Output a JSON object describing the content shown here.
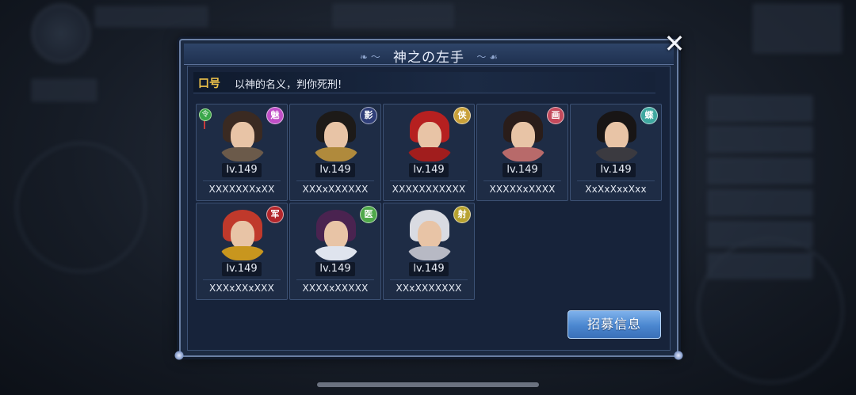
{
  "dialog": {
    "title": "神之の左手",
    "close_label": "✕"
  },
  "slogan": {
    "label": "口号",
    "text": "以神的名义，判你死刑!"
  },
  "members": [
    {
      "level": "lv.149",
      "name": "XXXXXXXxXX",
      "badge": "魅",
      "badge_color": "#c04fc7",
      "leader_icon": "令"
    },
    {
      "level": "lv.149",
      "name": "XXXxXXXXXX",
      "badge": "影",
      "badge_color": "#2f3e78"
    },
    {
      "level": "lv.149",
      "name": "XXXXXXXXXXX",
      "badge": "侠",
      "badge_color": "#c9a13a"
    },
    {
      "level": "lv.149",
      "name": "XXXXXxXXXX",
      "badge": "画",
      "badge_color": "#c44a5c"
    },
    {
      "level": "lv.149",
      "name": "XxXxXxxXxx",
      "badge": "蝶",
      "badge_color": "#3fa8a0"
    },
    {
      "level": "lv.149",
      "name": "XXXxXXxXXX",
      "badge": "军",
      "badge_color": "#b3262b"
    },
    {
      "level": "lv.149",
      "name": "XXXXxXXXXX",
      "badge": "医",
      "badge_color": "#4fa84a"
    },
    {
      "level": "lv.149",
      "name": "XXxXXXXXXX",
      "badge": "射",
      "badge_color": "#b8a230"
    }
  ],
  "recruit_button": "招募信息",
  "colors": {
    "accent": "#4a86cf",
    "slogan_label": "#f0c44a"
  }
}
